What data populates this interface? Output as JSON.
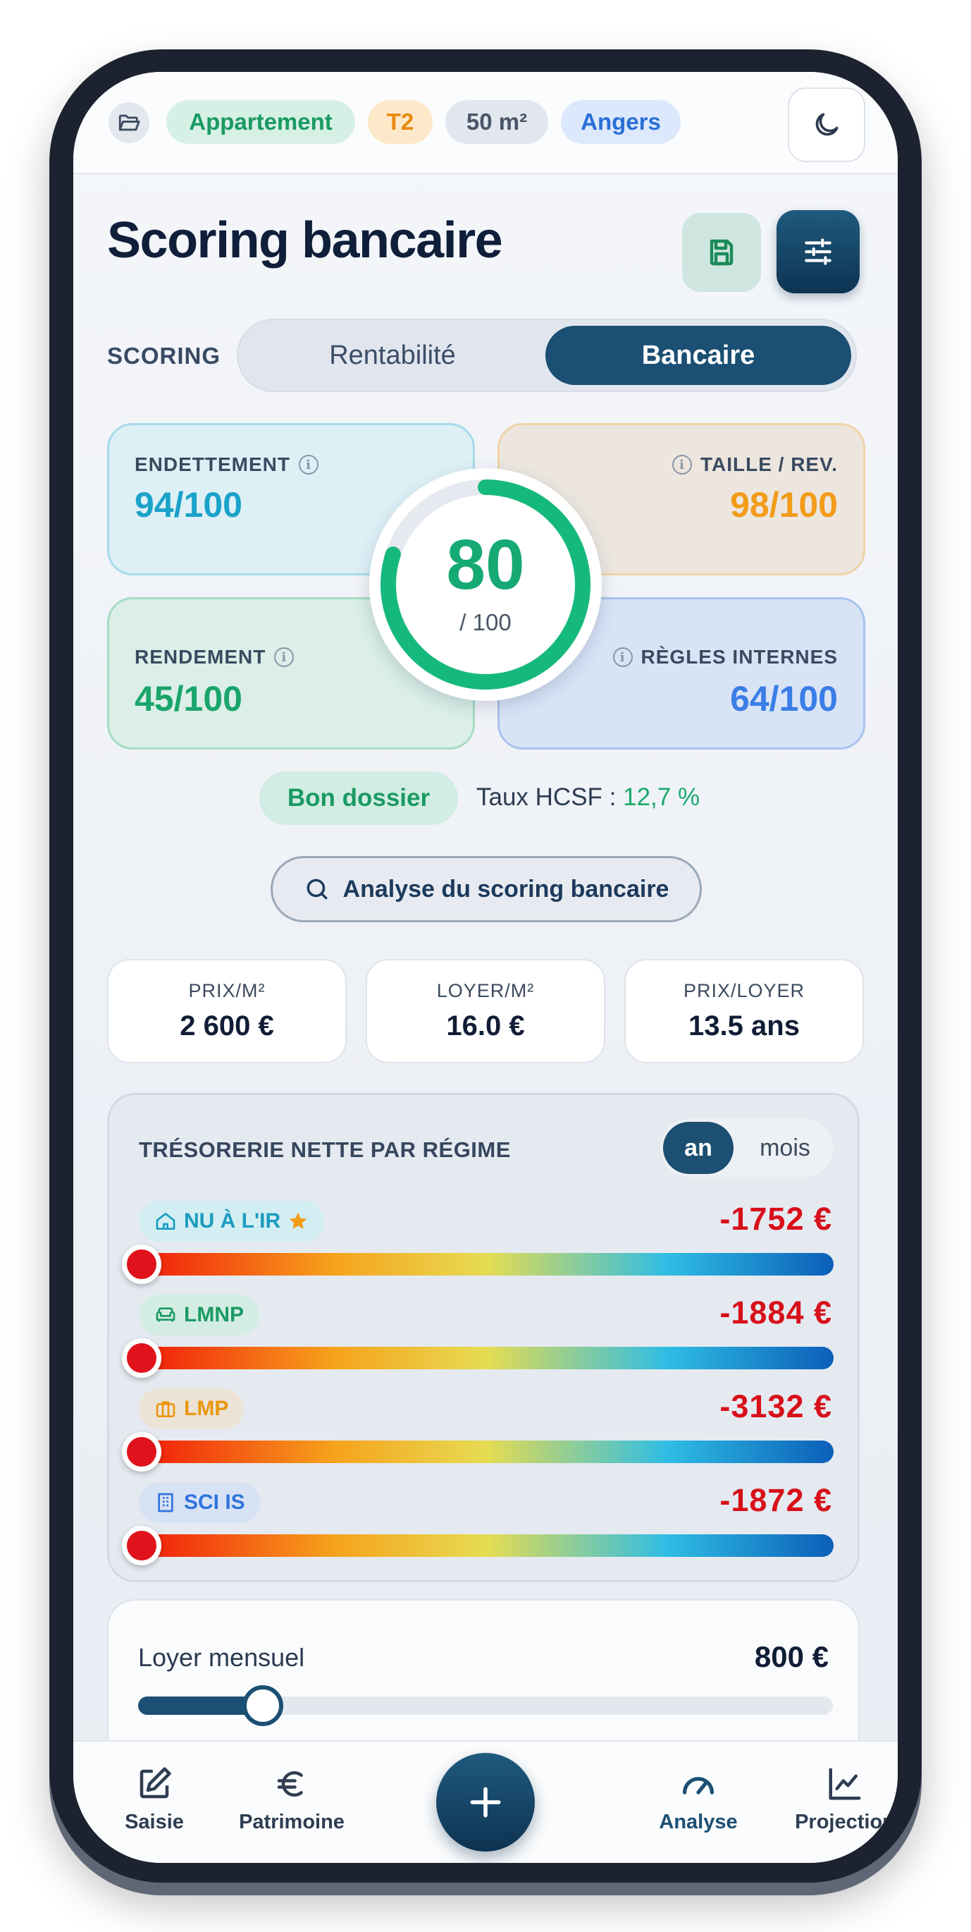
{
  "property": {
    "type": "Appartement",
    "layout": "T2",
    "surface": "50 m²",
    "city": "Angers"
  },
  "header": {
    "title": "Scoring bancaire"
  },
  "scoring_switch": {
    "label": "SCORING",
    "options": [
      "Rentabilité",
      "Bancaire"
    ],
    "selected": "Bancaire"
  },
  "scores": {
    "endettement": {
      "label": "ENDETTEMENT",
      "value": "94/100"
    },
    "taille_rev": {
      "label": "TAILLE / REV.",
      "value": "98/100"
    },
    "rendement": {
      "label": "RENDEMENT",
      "value": "45/100"
    },
    "regles_internes": {
      "label": "RÈGLES INTERNES",
      "value": "64/100"
    }
  },
  "global_score": {
    "value": "80",
    "max_label": "/ 100",
    "fraction": 0.8
  },
  "verdict": {
    "badge": "Bon dossier",
    "hcsf_label": "Taux HCSF :",
    "hcsf_value": "12,7 %"
  },
  "analyse_button": "Analyse du scoring bancaire",
  "stats": [
    {
      "label": "PRIX/M²",
      "value": "2 600 €"
    },
    {
      "label": "LOYER/M²",
      "value": "16.0 €"
    },
    {
      "label": "PRIX/LOYER",
      "value": "13.5 ans"
    }
  ],
  "tresorerie": {
    "title": "TRÉSORERIE NETTE PAR RÉGIME",
    "period_options": [
      "an",
      "mois"
    ],
    "period_selected": "an",
    "regimes": [
      {
        "name": "NU À L'IR",
        "amount": "-1752 €",
        "icon": "house-icon",
        "favorite": true,
        "level": 0.0
      },
      {
        "name": "LMNP",
        "amount": "-1884 €",
        "icon": "sofa-icon",
        "favorite": false,
        "level": 0.0
      },
      {
        "name": "LMP",
        "amount": "-3132 €",
        "icon": "briefcase-icon",
        "favorite": false,
        "level": 0.0
      },
      {
        "name": "SCI IS",
        "amount": "-1872 €",
        "icon": "building-icon",
        "favorite": false,
        "level": 0.0
      }
    ]
  },
  "loyer": {
    "label": "Loyer mensuel",
    "value": "800 €",
    "slider_fraction": 0.18
  },
  "nav": {
    "items": [
      {
        "label": "Saisie",
        "icon": "edit-icon"
      },
      {
        "label": "Patrimoine",
        "icon": "euro-icon"
      },
      {
        "label": "Analyse",
        "icon": "gauge-icon",
        "active": true
      },
      {
        "label": "Projection",
        "icon": "chart-line-icon"
      }
    ],
    "fab_icon": "plus-icon"
  },
  "colors": {
    "accent": "#1b4f73",
    "success": "#16a974",
    "danger": "#d8101a"
  }
}
